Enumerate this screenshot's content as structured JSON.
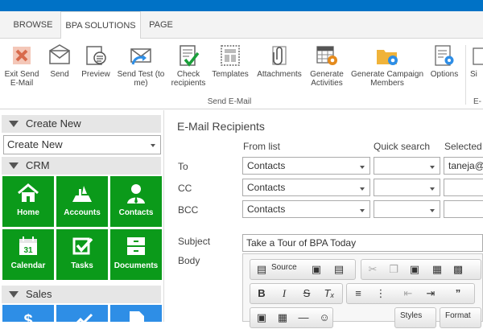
{
  "tabs": [
    {
      "label": "BROWSE"
    },
    {
      "label": "BPA SOLUTIONS"
    },
    {
      "label": "PAGE"
    }
  ],
  "ribbon": {
    "group_label": "Send E-Mail",
    "buttons": [
      {
        "label": "Exit Send E-Mail",
        "icon": "close-x-icon"
      },
      {
        "label": "Send",
        "icon": "envelope-icon"
      },
      {
        "label": "Preview",
        "icon": "preview-icon"
      },
      {
        "label": "Send Test (to me)",
        "icon": "send-test-icon"
      },
      {
        "label": "Check recipients",
        "icon": "checklist-icon"
      },
      {
        "label": "Templates",
        "icon": "templates-icon"
      },
      {
        "label": "Attachments",
        "icon": "paperclip-icon"
      },
      {
        "label": "Generate Activities",
        "icon": "grid-gear-icon"
      },
      {
        "label": "Generate Campaign Members",
        "icon": "folder-gear-icon"
      },
      {
        "label": "Options",
        "icon": "options-icon"
      },
      {
        "label": "Si",
        "icon": "partial-icon"
      }
    ],
    "partial_text": "E-"
  },
  "sidebar": {
    "create_new_header": "Create New",
    "create_new_select": "Create New",
    "crm_header": "CRM",
    "crm_tiles": [
      {
        "label": "Home",
        "icon": "home-icon"
      },
      {
        "label": "Accounts",
        "icon": "accounts-icon"
      },
      {
        "label": "Contacts",
        "icon": "contacts-icon"
      },
      {
        "label": "Calendar",
        "icon": "calendar-icon"
      },
      {
        "label": "Tasks",
        "icon": "tasks-icon"
      },
      {
        "label": "Documents",
        "icon": "documents-icon"
      }
    ],
    "calendar_day": "31",
    "sales_header": "Sales",
    "colors": {
      "crm_tile": "#0b9a1a",
      "sales_tile": "#2e8ee6"
    }
  },
  "main": {
    "title": "E-Mail Recipients",
    "col_from_list": "From list",
    "col_quick_search": "Quick search",
    "col_selected": "Selected",
    "rows": [
      {
        "label": "To",
        "from_list": "Contacts",
        "selected": "taneja@"
      },
      {
        "label": "CC",
        "from_list": "Contacts",
        "selected": ""
      },
      {
        "label": "BCC",
        "from_list": "Contacts",
        "selected": ""
      }
    ],
    "subject_label": "Subject",
    "subject_value": "Take a Tour of BPA Today",
    "body_label": "Body",
    "editor": {
      "source": "Source",
      "styles": "Styles",
      "format": "Format"
    }
  }
}
